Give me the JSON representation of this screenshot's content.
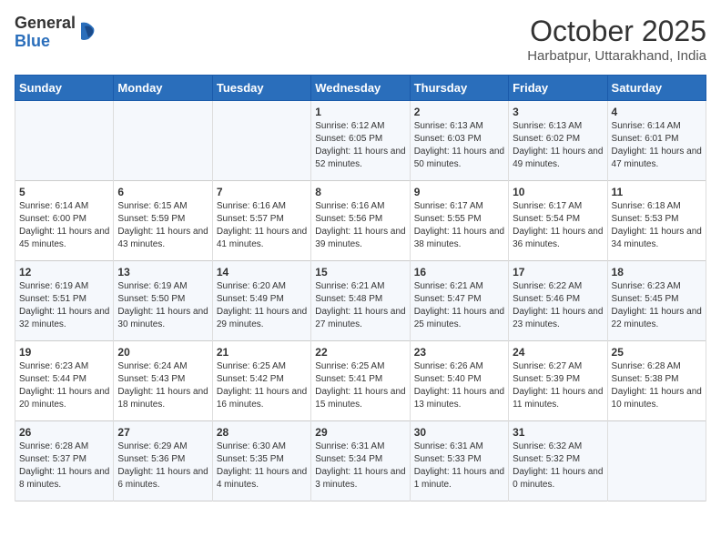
{
  "logo": {
    "general": "General",
    "blue": "Blue"
  },
  "header": {
    "title": "October 2025",
    "subtitle": "Harbatpur, Uttarakhand, India"
  },
  "weekdays": [
    "Sunday",
    "Monday",
    "Tuesday",
    "Wednesday",
    "Thursday",
    "Friday",
    "Saturday"
  ],
  "weeks": [
    [
      {
        "day": "",
        "sunrise": "",
        "sunset": "",
        "daylight": ""
      },
      {
        "day": "",
        "sunrise": "",
        "sunset": "",
        "daylight": ""
      },
      {
        "day": "",
        "sunrise": "",
        "sunset": "",
        "daylight": ""
      },
      {
        "day": "1",
        "sunrise": "Sunrise: 6:12 AM",
        "sunset": "Sunset: 6:05 PM",
        "daylight": "Daylight: 11 hours and 52 minutes."
      },
      {
        "day": "2",
        "sunrise": "Sunrise: 6:13 AM",
        "sunset": "Sunset: 6:03 PM",
        "daylight": "Daylight: 11 hours and 50 minutes."
      },
      {
        "day": "3",
        "sunrise": "Sunrise: 6:13 AM",
        "sunset": "Sunset: 6:02 PM",
        "daylight": "Daylight: 11 hours and 49 minutes."
      },
      {
        "day": "4",
        "sunrise": "Sunrise: 6:14 AM",
        "sunset": "Sunset: 6:01 PM",
        "daylight": "Daylight: 11 hours and 47 minutes."
      }
    ],
    [
      {
        "day": "5",
        "sunrise": "Sunrise: 6:14 AM",
        "sunset": "Sunset: 6:00 PM",
        "daylight": "Daylight: 11 hours and 45 minutes."
      },
      {
        "day": "6",
        "sunrise": "Sunrise: 6:15 AM",
        "sunset": "Sunset: 5:59 PM",
        "daylight": "Daylight: 11 hours and 43 minutes."
      },
      {
        "day": "7",
        "sunrise": "Sunrise: 6:16 AM",
        "sunset": "Sunset: 5:57 PM",
        "daylight": "Daylight: 11 hours and 41 minutes."
      },
      {
        "day": "8",
        "sunrise": "Sunrise: 6:16 AM",
        "sunset": "Sunset: 5:56 PM",
        "daylight": "Daylight: 11 hours and 39 minutes."
      },
      {
        "day": "9",
        "sunrise": "Sunrise: 6:17 AM",
        "sunset": "Sunset: 5:55 PM",
        "daylight": "Daylight: 11 hours and 38 minutes."
      },
      {
        "day": "10",
        "sunrise": "Sunrise: 6:17 AM",
        "sunset": "Sunset: 5:54 PM",
        "daylight": "Daylight: 11 hours and 36 minutes."
      },
      {
        "day": "11",
        "sunrise": "Sunrise: 6:18 AM",
        "sunset": "Sunset: 5:53 PM",
        "daylight": "Daylight: 11 hours and 34 minutes."
      }
    ],
    [
      {
        "day": "12",
        "sunrise": "Sunrise: 6:19 AM",
        "sunset": "Sunset: 5:51 PM",
        "daylight": "Daylight: 11 hours and 32 minutes."
      },
      {
        "day": "13",
        "sunrise": "Sunrise: 6:19 AM",
        "sunset": "Sunset: 5:50 PM",
        "daylight": "Daylight: 11 hours and 30 minutes."
      },
      {
        "day": "14",
        "sunrise": "Sunrise: 6:20 AM",
        "sunset": "Sunset: 5:49 PM",
        "daylight": "Daylight: 11 hours and 29 minutes."
      },
      {
        "day": "15",
        "sunrise": "Sunrise: 6:21 AM",
        "sunset": "Sunset: 5:48 PM",
        "daylight": "Daylight: 11 hours and 27 minutes."
      },
      {
        "day": "16",
        "sunrise": "Sunrise: 6:21 AM",
        "sunset": "Sunset: 5:47 PM",
        "daylight": "Daylight: 11 hours and 25 minutes."
      },
      {
        "day": "17",
        "sunrise": "Sunrise: 6:22 AM",
        "sunset": "Sunset: 5:46 PM",
        "daylight": "Daylight: 11 hours and 23 minutes."
      },
      {
        "day": "18",
        "sunrise": "Sunrise: 6:23 AM",
        "sunset": "Sunset: 5:45 PM",
        "daylight": "Daylight: 11 hours and 22 minutes."
      }
    ],
    [
      {
        "day": "19",
        "sunrise": "Sunrise: 6:23 AM",
        "sunset": "Sunset: 5:44 PM",
        "daylight": "Daylight: 11 hours and 20 minutes."
      },
      {
        "day": "20",
        "sunrise": "Sunrise: 6:24 AM",
        "sunset": "Sunset: 5:43 PM",
        "daylight": "Daylight: 11 hours and 18 minutes."
      },
      {
        "day": "21",
        "sunrise": "Sunrise: 6:25 AM",
        "sunset": "Sunset: 5:42 PM",
        "daylight": "Daylight: 11 hours and 16 minutes."
      },
      {
        "day": "22",
        "sunrise": "Sunrise: 6:25 AM",
        "sunset": "Sunset: 5:41 PM",
        "daylight": "Daylight: 11 hours and 15 minutes."
      },
      {
        "day": "23",
        "sunrise": "Sunrise: 6:26 AM",
        "sunset": "Sunset: 5:40 PM",
        "daylight": "Daylight: 11 hours and 13 minutes."
      },
      {
        "day": "24",
        "sunrise": "Sunrise: 6:27 AM",
        "sunset": "Sunset: 5:39 PM",
        "daylight": "Daylight: 11 hours and 11 minutes."
      },
      {
        "day": "25",
        "sunrise": "Sunrise: 6:28 AM",
        "sunset": "Sunset: 5:38 PM",
        "daylight": "Daylight: 11 hours and 10 minutes."
      }
    ],
    [
      {
        "day": "26",
        "sunrise": "Sunrise: 6:28 AM",
        "sunset": "Sunset: 5:37 PM",
        "daylight": "Daylight: 11 hours and 8 minutes."
      },
      {
        "day": "27",
        "sunrise": "Sunrise: 6:29 AM",
        "sunset": "Sunset: 5:36 PM",
        "daylight": "Daylight: 11 hours and 6 minutes."
      },
      {
        "day": "28",
        "sunrise": "Sunrise: 6:30 AM",
        "sunset": "Sunset: 5:35 PM",
        "daylight": "Daylight: 11 hours and 4 minutes."
      },
      {
        "day": "29",
        "sunrise": "Sunrise: 6:31 AM",
        "sunset": "Sunset: 5:34 PM",
        "daylight": "Daylight: 11 hours and 3 minutes."
      },
      {
        "day": "30",
        "sunrise": "Sunrise: 6:31 AM",
        "sunset": "Sunset: 5:33 PM",
        "daylight": "Daylight: 11 hours and 1 minute."
      },
      {
        "day": "31",
        "sunrise": "Sunrise: 6:32 AM",
        "sunset": "Sunset: 5:32 PM",
        "daylight": "Daylight: 11 hours and 0 minutes."
      },
      {
        "day": "",
        "sunrise": "",
        "sunset": "",
        "daylight": ""
      }
    ]
  ]
}
